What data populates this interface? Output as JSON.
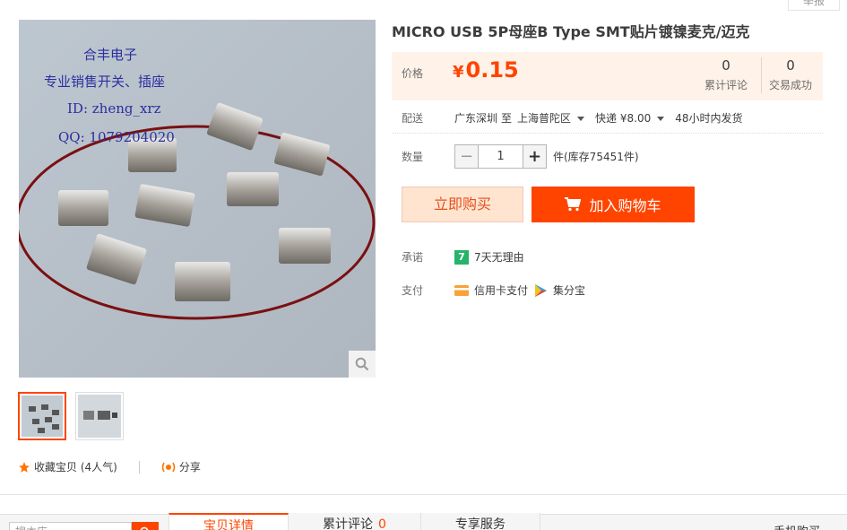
{
  "header": {
    "report_label": "举报"
  },
  "gallery": {
    "watermark": [
      "合丰电子",
      "专业销售开关、插座",
      "ID: zheng_xrz",
      "QQ: 1079204020"
    ],
    "thumbnails": [
      {
        "active": true
      },
      {
        "active": false
      }
    ]
  },
  "social": {
    "favorite_label": "收藏宝贝 (4人气)",
    "share_label": "分享"
  },
  "product": {
    "title": "MICRO USB 5P母座B Type SMT贴片镀镍麦克/迈克",
    "price_label": "价格",
    "currency": "¥",
    "price": "0.15",
    "stats": [
      {
        "value": "0",
        "label": "累计评论"
      },
      {
        "value": "0",
        "label": "交易成功"
      }
    ],
    "delivery": {
      "label": "配送",
      "from": "广东深圳",
      "to_word": "至",
      "to": "上海普陀区",
      "method": "快递 ¥8.00",
      "ship_time": "48小时内发货"
    },
    "quantity": {
      "label": "数量",
      "minus": "−",
      "value": "1",
      "plus": "+",
      "stock": "件(库存75451件)"
    },
    "buy_now_label": "立即购买",
    "add_to_cart_label": "加入购物车",
    "promise": {
      "label": "承诺",
      "badge": "7",
      "text": "7天无理由"
    },
    "payment": {
      "label": "支付",
      "methods": [
        "信用卡支付",
        "集分宝"
      ]
    }
  },
  "bottom": {
    "search_placeholder": "搜本店",
    "tabs": [
      {
        "label": "宝贝详情",
        "active": true
      },
      {
        "label": "累计评论",
        "count": "0"
      },
      {
        "label": "专享服务"
      }
    ],
    "phone_order": "手机购买"
  },
  "colors": {
    "accent": "#ff4400",
    "price_bg": "#fff2e8",
    "promise_green": "#26b36b"
  }
}
